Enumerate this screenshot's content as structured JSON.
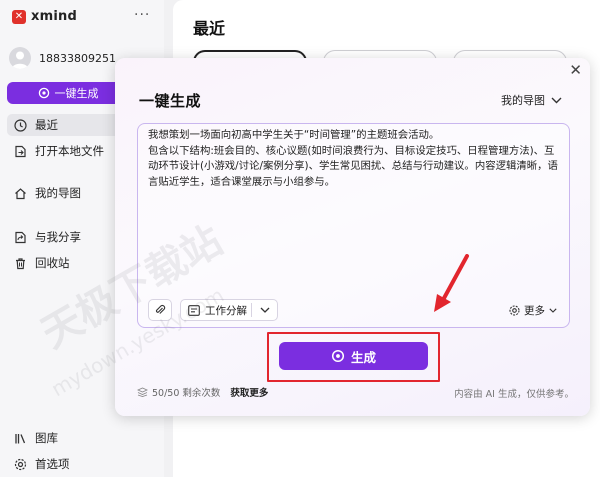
{
  "app": {
    "brand": "xmind",
    "more_icon": "more-horizontal-icon",
    "user_name": "18833809251"
  },
  "sidebar": {
    "oneclick_label": "一键生成",
    "items": [
      {
        "label": "最近",
        "icon": "clock-icon",
        "active": true
      },
      {
        "label": "打开本地文件",
        "icon": "open-file-icon",
        "active": false
      },
      {
        "label": "我的导图",
        "icon": "home-icon",
        "active": false
      },
      {
        "label": "与我分享",
        "icon": "share-icon",
        "active": false
      },
      {
        "label": "回收站",
        "icon": "trash-icon",
        "active": false
      },
      {
        "label": "图库",
        "icon": "library-icon",
        "active": false
      },
      {
        "label": "首选项",
        "icon": "settings-icon",
        "active": false
      }
    ]
  },
  "main": {
    "title": "最近"
  },
  "dialog": {
    "title": "一键生成",
    "map_select": "我的导图",
    "prompt": "我想策划一场面向初高中学生关于“时间管理”的主题班会活动。\n包含以下结构:班会目的、核心议题(如时间浪费行为、目标设定技巧、日程管理方法)、互动环节设计(小游戏/讨论/案例分享)、学生常见困扰、总结与行动建议。内容逻辑清晰，语言贴近学生，适合课堂展示与小组参与。",
    "template_label": "工作分解",
    "more_label": "更多",
    "generate_label": "生成",
    "quota": "50/50 剩余次数",
    "get_more": "获取更多",
    "ai_note": "内容由 AI 生成，仅供参考。"
  },
  "overlay": {
    "watermark": "天极下载站",
    "watermark_url": "mydown.yesky.com",
    "highlight_color": "#e2262e"
  },
  "colors": {
    "accent": "#7b2ee0",
    "brand_red": "#e0312b",
    "annotation_red": "#e2262e"
  }
}
